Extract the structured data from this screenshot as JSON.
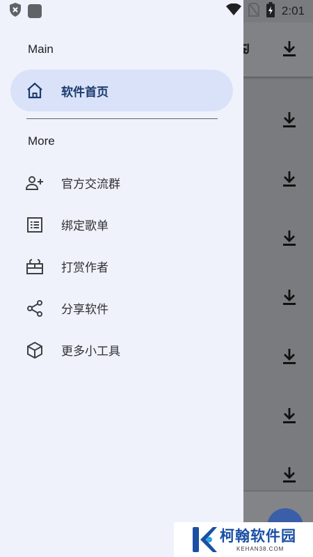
{
  "status_bar": {
    "time": "2:01",
    "icons": [
      "shield-x-icon",
      "app-square-icon",
      "wifi-icon",
      "no-sim-icon",
      "battery-charging-icon"
    ]
  },
  "drawer": {
    "main_section_title": "Main",
    "active_item": {
      "label": "软件首页",
      "icon": "home-icon"
    },
    "more_section_title": "More",
    "items": [
      {
        "label": "官方交流群",
        "icon": "person-add-icon"
      },
      {
        "label": "绑定歌单",
        "icon": "list-icon"
      },
      {
        "label": "打赏作者",
        "icon": "gift-icon"
      },
      {
        "label": "分享软件",
        "icon": "share-icon"
      },
      {
        "label": "更多小工具",
        "icon": "cube-icon"
      }
    ]
  },
  "watermark": {
    "title": "柯翰软件园",
    "subtitle": "KEHAN38.COM"
  },
  "colors": {
    "drawer_bg": "#f0f2fb",
    "active_pill": "#d9e2f9",
    "active_text": "#1b3a6b",
    "scrim_bg": "#7a7b7f",
    "watermark_blue": "#1a4fa3"
  }
}
